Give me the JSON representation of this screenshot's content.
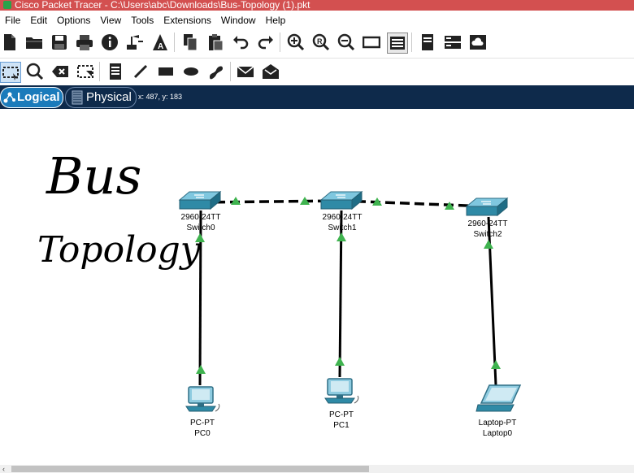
{
  "window": {
    "title": "Cisco Packet Tracer - C:\\Users\\abc\\Downloads\\Bus-Topology (1).pkt"
  },
  "menu": [
    "File",
    "Edit",
    "Options",
    "View",
    "Tools",
    "Extensions",
    "Window",
    "Help"
  ],
  "toolbar1": [
    "new-icon",
    "open-icon",
    "save-icon",
    "print-icon",
    "info-icon",
    "network-wizard-icon",
    "activity-wizard-icon",
    "copy-icon",
    "paste-icon",
    "undo-icon",
    "redo-icon",
    "zoom-in-icon",
    "zoom-reset-icon",
    "zoom-out-icon",
    "drawing-palette-icon",
    "custom-device-dialog-icon",
    "pdu-list-icon",
    "cluster-icon",
    "cloud-view-icon"
  ],
  "toolbar2": [
    "select-icon",
    "inspect-icon",
    "delete-icon",
    "resize-shape-icon",
    "place-note-icon",
    "draw-line-icon",
    "draw-rectangle-icon",
    "draw-ellipse-icon",
    "freeform-icon",
    "add-simple-pdu-icon",
    "add-complex-pdu-icon"
  ],
  "modes": {
    "logical": "Logical",
    "physical": "Physical"
  },
  "cursor_coords": "x: 487, y: 183",
  "handwriting": {
    "line1": "Bus",
    "line2": "Topology"
  },
  "devices": {
    "switch0": {
      "model": "2960-24TT",
      "name": "Switch0"
    },
    "switch1": {
      "model": "2960-24TT",
      "name": "Switch1"
    },
    "switch2": {
      "model": "2960-24TT",
      "name": "Switch2"
    },
    "pc0": {
      "model": "PC-PT",
      "name": "PC0"
    },
    "pc1": {
      "model": "PC-PT",
      "name": "PC1"
    },
    "laptop0": {
      "model": "Laptop-PT",
      "name": "Laptop0"
    }
  },
  "link_status_color": "#3fb34f",
  "colors": {
    "titlebar": "#d35050",
    "modebar": "#0e2a4b",
    "logical_active": "#1b7bbb"
  }
}
